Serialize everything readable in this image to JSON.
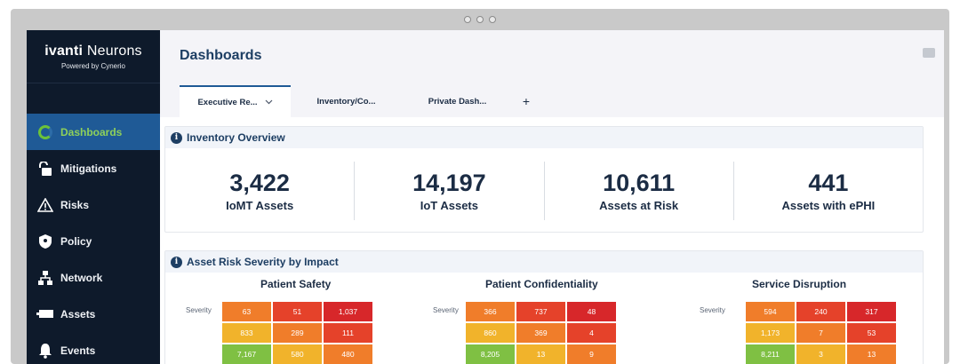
{
  "window_controls": [
    "dot",
    "dot",
    "dot"
  ],
  "brand": {
    "name_bold": "ivanti",
    "name_light": "Neurons",
    "subtitle": "Powered by Cynerio"
  },
  "sidebar": {
    "items": [
      {
        "label": "Dashboards",
        "icon": "dashboards-ring-icon",
        "active": true
      },
      {
        "label": "Mitigations",
        "icon": "lock-icon",
        "active": false
      },
      {
        "label": "Risks",
        "icon": "warning-icon",
        "active": false
      },
      {
        "label": "Policy",
        "icon": "shield-icon",
        "active": false
      },
      {
        "label": "Network",
        "icon": "network-icon",
        "active": false
      },
      {
        "label": "Assets",
        "icon": "assets-icon",
        "active": false
      },
      {
        "label": "Events",
        "icon": "bell-icon",
        "active": false
      }
    ]
  },
  "header": {
    "title": "Dashboards"
  },
  "tabs": [
    {
      "label": "Executive Re...",
      "active": true,
      "has_chevron": true
    },
    {
      "label": "Inventory/Co...",
      "active": false
    },
    {
      "label": "Private Dash...",
      "active": false
    }
  ],
  "tab_add_label": "+",
  "inventory": {
    "title": "Inventory Overview",
    "kpis": [
      {
        "value": "3,422",
        "label": "IoMT Assets"
      },
      {
        "value": "14,197",
        "label": "IoT Assets"
      },
      {
        "value": "10,611",
        "label": "Assets at Risk"
      },
      {
        "value": "441",
        "label": "Assets with ePHI"
      }
    ]
  },
  "risk": {
    "title": "Asset Risk Severity by Impact",
    "row_label": "Severity",
    "heatmaps": [
      {
        "title": "Patient Safety",
        "cells": [
          [
            {
              "v": "63",
              "c": "#f07d2a"
            },
            {
              "v": "51",
              "c": "#e5422a"
            },
            {
              "v": "1,037",
              "c": "#d7272a"
            }
          ],
          [
            {
              "v": "833",
              "c": "#f1b32b"
            },
            {
              "v": "289",
              "c": "#f07d2a"
            },
            {
              "v": "111",
              "c": "#e5422a"
            }
          ],
          [
            {
              "v": "7,167",
              "c": "#7fc043"
            },
            {
              "v": "580",
              "c": "#f1b32b"
            },
            {
              "v": "480",
              "c": "#f07d2a"
            }
          ]
        ]
      },
      {
        "title": "Patient Confidentiality",
        "cells": [
          [
            {
              "v": "366",
              "c": "#f07d2a"
            },
            {
              "v": "737",
              "c": "#e5422a"
            },
            {
              "v": "48",
              "c": "#d7272a"
            }
          ],
          [
            {
              "v": "860",
              "c": "#f1b32b"
            },
            {
              "v": "369",
              "c": "#f07d2a"
            },
            {
              "v": "4",
              "c": "#e5422a"
            }
          ],
          [
            {
              "v": "8,205",
              "c": "#7fc043"
            },
            {
              "v": "13",
              "c": "#f1b32b"
            },
            {
              "v": "9",
              "c": "#f07d2a"
            }
          ]
        ]
      },
      {
        "title": "Service Disruption",
        "cells": [
          [
            {
              "v": "594",
              "c": "#f07d2a"
            },
            {
              "v": "240",
              "c": "#e5422a"
            },
            {
              "v": "317",
              "c": "#d7272a"
            }
          ],
          [
            {
              "v": "1,173",
              "c": "#f1b32b"
            },
            {
              "v": "7",
              "c": "#f07d2a"
            },
            {
              "v": "53",
              "c": "#e5422a"
            }
          ],
          [
            {
              "v": "8,211",
              "c": "#7fc043"
            },
            {
              "v": "3",
              "c": "#f1b32b"
            },
            {
              "v": "13",
              "c": "#f07d2a"
            }
          ]
        ]
      }
    ]
  }
}
